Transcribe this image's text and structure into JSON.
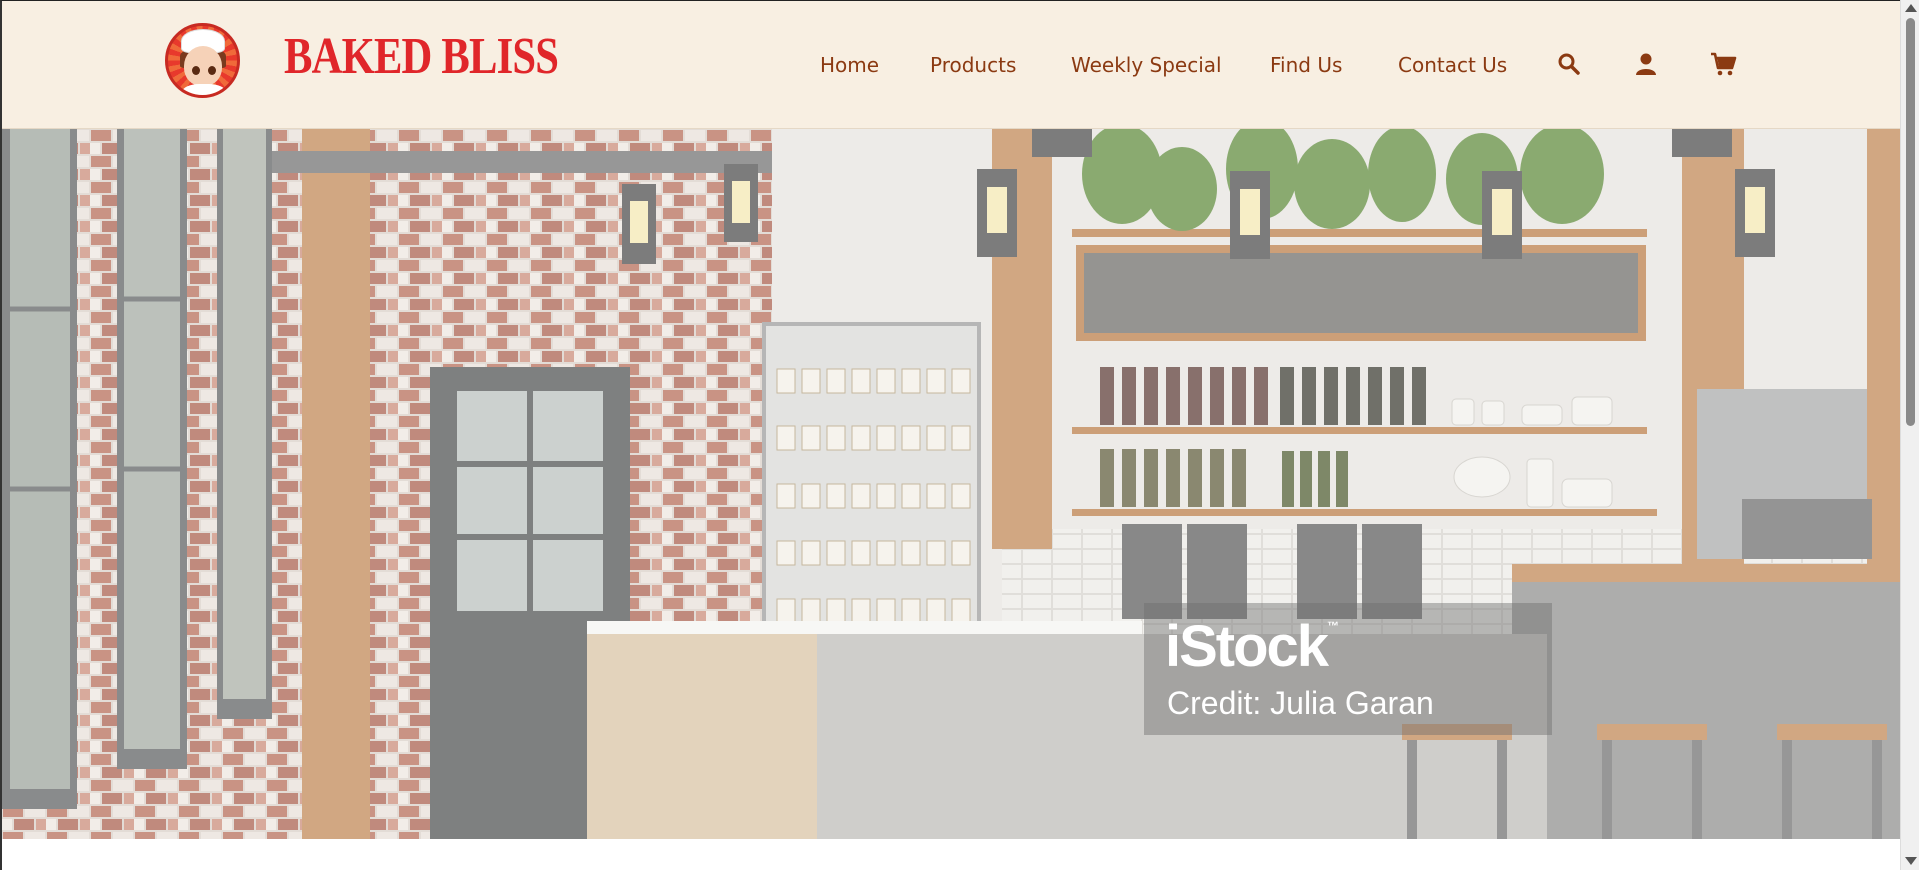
{
  "brand": {
    "name": "BAKED BLISS",
    "logo_icon": "chef-girl-logo"
  },
  "nav": {
    "items": [
      {
        "label": "Home"
      },
      {
        "label": "Products"
      },
      {
        "label": "Weekly Special"
      },
      {
        "label": "Find Us"
      },
      {
        "label": "Contact Us"
      }
    ],
    "icons": [
      "search-icon",
      "user-icon",
      "cart-icon"
    ]
  },
  "hero": {
    "watermark": {
      "brand": "iStock",
      "trademark": "™",
      "credit": "Credit: Julia Garan"
    }
  },
  "colors": {
    "header_bg": "#f8efe2",
    "brand": "#e0262a",
    "nav_text": "#8b3a12"
  }
}
